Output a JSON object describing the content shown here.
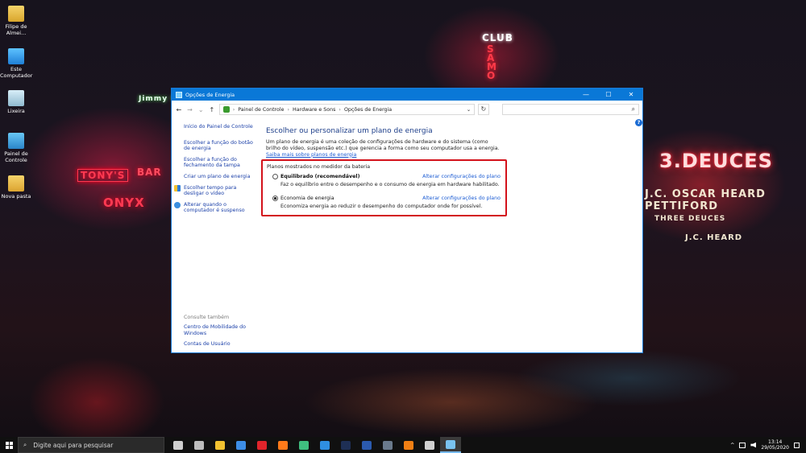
{
  "desktop": {
    "icons": [
      {
        "label": "Filipe de\nAlmei..."
      },
      {
        "label": "Este\nComputador"
      },
      {
        "label": "Lixeira"
      },
      {
        "label": "Painel de\nControle"
      },
      {
        "label": "Nova pasta"
      }
    ],
    "wallpaper_signs": {
      "club": "CLUB",
      "samo": "SAMO",
      "jimmy": "Jimmy Ryan's",
      "tonys": "TONY'S",
      "bar": "BAR",
      "onyx": "ONYX",
      "deuces": "3.DEUCES",
      "heard": "J.C. OSCAR HEARD PETTIFORD",
      "three_deuces": "THREE DEUCES",
      "jc_heard": "J.C. HEARD"
    }
  },
  "window": {
    "title": "Opções de Energia",
    "controls": {
      "minimize": "—",
      "maximize": "☐",
      "close": "✕"
    },
    "nav": {
      "back": "←",
      "forward": "→",
      "recent": "⌄",
      "up": "↑"
    },
    "address": {
      "crumbs": [
        "Painel de Controle",
        "Hardware e Sons",
        "Opções de Energia"
      ],
      "separator": "›",
      "dropdown": "⌄",
      "refresh": "↻"
    },
    "search_glyph": "⌕",
    "help_glyph": "?",
    "sidebar": {
      "home": "Início do Painel de Controle",
      "links": [
        "Escolher a função do botão de energia",
        "Escolher a função do fechamento da tampa",
        "Criar um plano de energia",
        "Escolher tempo para desligar o vídeo",
        "Alterar quando o computador é suspenso"
      ],
      "see_also": {
        "header": "Consulte também",
        "links": [
          "Centro de Mobilidade do Windows",
          "Contas de Usuário"
        ]
      }
    },
    "main": {
      "title": "Escolher ou personalizar um plano de energia",
      "description": "Um plano de energia é uma coleção de configurações de hardware e do sistema (como brilho do vídeo, suspensão etc.) que gerencia a forma como seu computador usa a energia.",
      "learn_more": "Saiba mais sobre planos de energia",
      "plans_header": "Planos mostrados no medidor da bateria",
      "plans": [
        {
          "name": "Equilibrado (recomendável)",
          "bold": true,
          "checked": false,
          "link": "Alterar configurações do plano",
          "description": "Faz o equilíbrio entre o desempenho e o consumo de energia em hardware habilitado."
        },
        {
          "name": "Economia de energia",
          "bold": false,
          "checked": true,
          "link": "Alterar configurações do plano",
          "description": "Economiza energia ao reduzir o desempenho do computador onde for possível."
        }
      ]
    }
  },
  "taskbar": {
    "search_placeholder": "Digite aqui para pesquisar",
    "search_glyph": "⌕",
    "apps": [
      {
        "name": "task-view",
        "color": "#cfcfcf"
      },
      {
        "name": "settings-gear",
        "color": "#bdbdbd"
      },
      {
        "name": "file-explorer",
        "color": "#f2c230"
      },
      {
        "name": "mail",
        "color": "#3d8ee6"
      },
      {
        "name": "opera",
        "color": "#e0242b"
      },
      {
        "name": "firefox",
        "color": "#ff7a1a"
      },
      {
        "name": "app-green",
        "color": "#3fbf7f"
      },
      {
        "name": "vscode",
        "color": "#2f8fe0"
      },
      {
        "name": "photoshop",
        "color": "#1e2f55"
      },
      {
        "name": "word",
        "color": "#2b5aad"
      },
      {
        "name": "steam",
        "color": "#6a7a8c"
      },
      {
        "name": "vlc",
        "color": "#f07f14"
      },
      {
        "name": "settings",
        "color": "#d0d0d0"
      },
      {
        "name": "power-options",
        "color": "#79c3f0"
      }
    ],
    "tray": {
      "chevron": "^",
      "time": "13:14",
      "date": "29/05/2020"
    }
  }
}
